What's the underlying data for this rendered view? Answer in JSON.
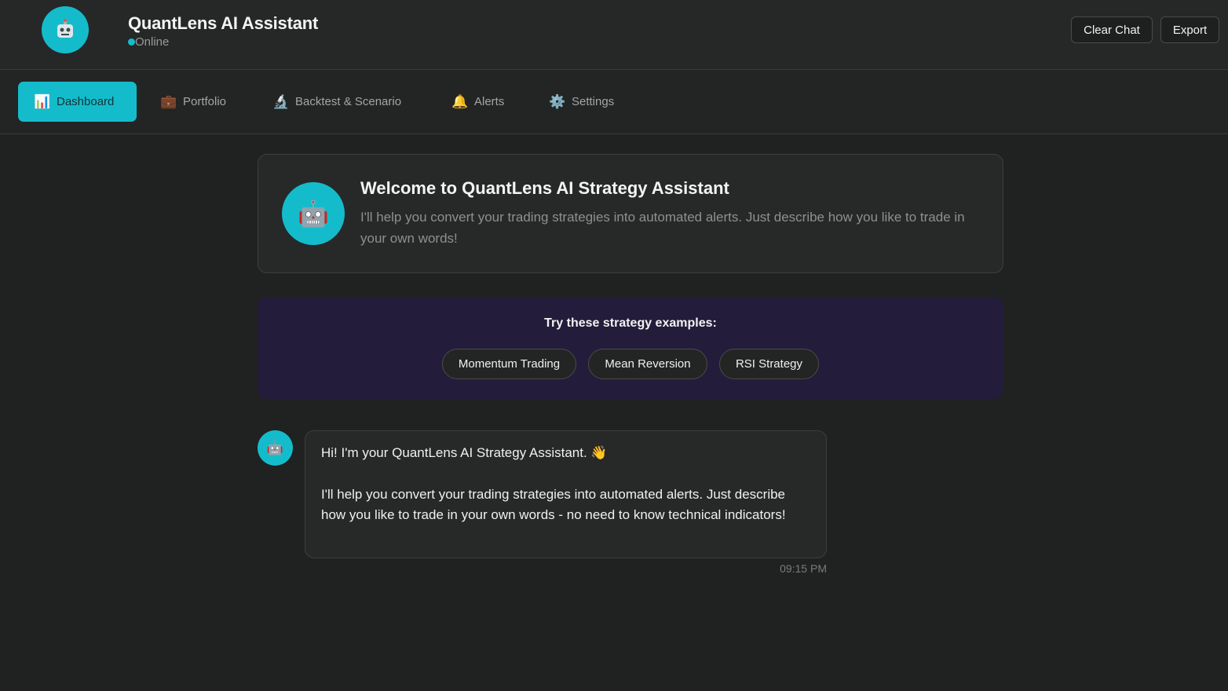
{
  "header": {
    "avatar_icon": "robot-icon",
    "title": "QuantLens AI Assistant",
    "status": "Online",
    "status_color": "#14bccb",
    "clear_label": "Clear Chat",
    "export_label": "Export"
  },
  "nav": {
    "active_color": "#14bccb",
    "items": [
      {
        "icon": "📊",
        "icon_name": "bar-chart-icon",
        "label": "Dashboard",
        "active": true
      },
      {
        "icon": "💼",
        "icon_name": "briefcase-icon",
        "label": "Portfolio",
        "active": false
      },
      {
        "icon": "🔬",
        "icon_name": "microscope-icon",
        "label": "Backtest & Scenario",
        "active": false
      },
      {
        "icon": "🔔",
        "icon_name": "bell-icon",
        "label": "Alerts",
        "active": false
      },
      {
        "icon": "⚙️",
        "icon_name": "gear-icon",
        "label": "Settings",
        "active": false
      }
    ]
  },
  "welcome": {
    "icon": "🤖",
    "title": "Welcome to QuantLens AI Strategy Assistant",
    "description": "I'll help you convert your trading strategies into automated alerts. Just describe how you like to trade in your own words!"
  },
  "examples": {
    "title": "Try these strategy examples:",
    "chips": [
      "Momentum Trading",
      "Mean Reversion",
      "RSI Strategy"
    ]
  },
  "message": {
    "icon": "🤖",
    "line1": "Hi! I'm your QuantLens AI Strategy Assistant. 👋",
    "line2": "I'll help you convert your trading strategies into automated alerts. Just describe how you like to trade in your own words - no need to know technical indicators!",
    "time": "09:15 PM"
  }
}
